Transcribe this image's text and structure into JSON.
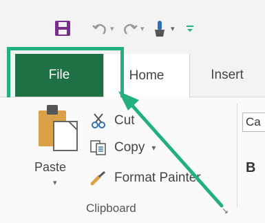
{
  "quick_access": {
    "icons": [
      "save-icon",
      "undo-icon",
      "redo-icon",
      "touch-mode-icon",
      "customize-icon"
    ],
    "dropdown_glyph": "▾"
  },
  "tabs": [
    {
      "label": "File"
    },
    {
      "label": "Home"
    },
    {
      "label": "Insert"
    }
  ],
  "clipboard": {
    "paste_label": "Paste",
    "paste_caret": "▾",
    "cut_label": "Cut",
    "copy_label": "Copy",
    "copy_caret": "▾",
    "format_painter_label": "Format Painter",
    "group_label": "Clipboard",
    "launcher_glyph": "↘"
  },
  "font_group": {
    "font_name_partial": "Ca",
    "bold_glyph": "B"
  },
  "colors": {
    "file_tab": "#1e7145",
    "highlight": "#22b07d",
    "save_icon": "#7a2d8c"
  }
}
